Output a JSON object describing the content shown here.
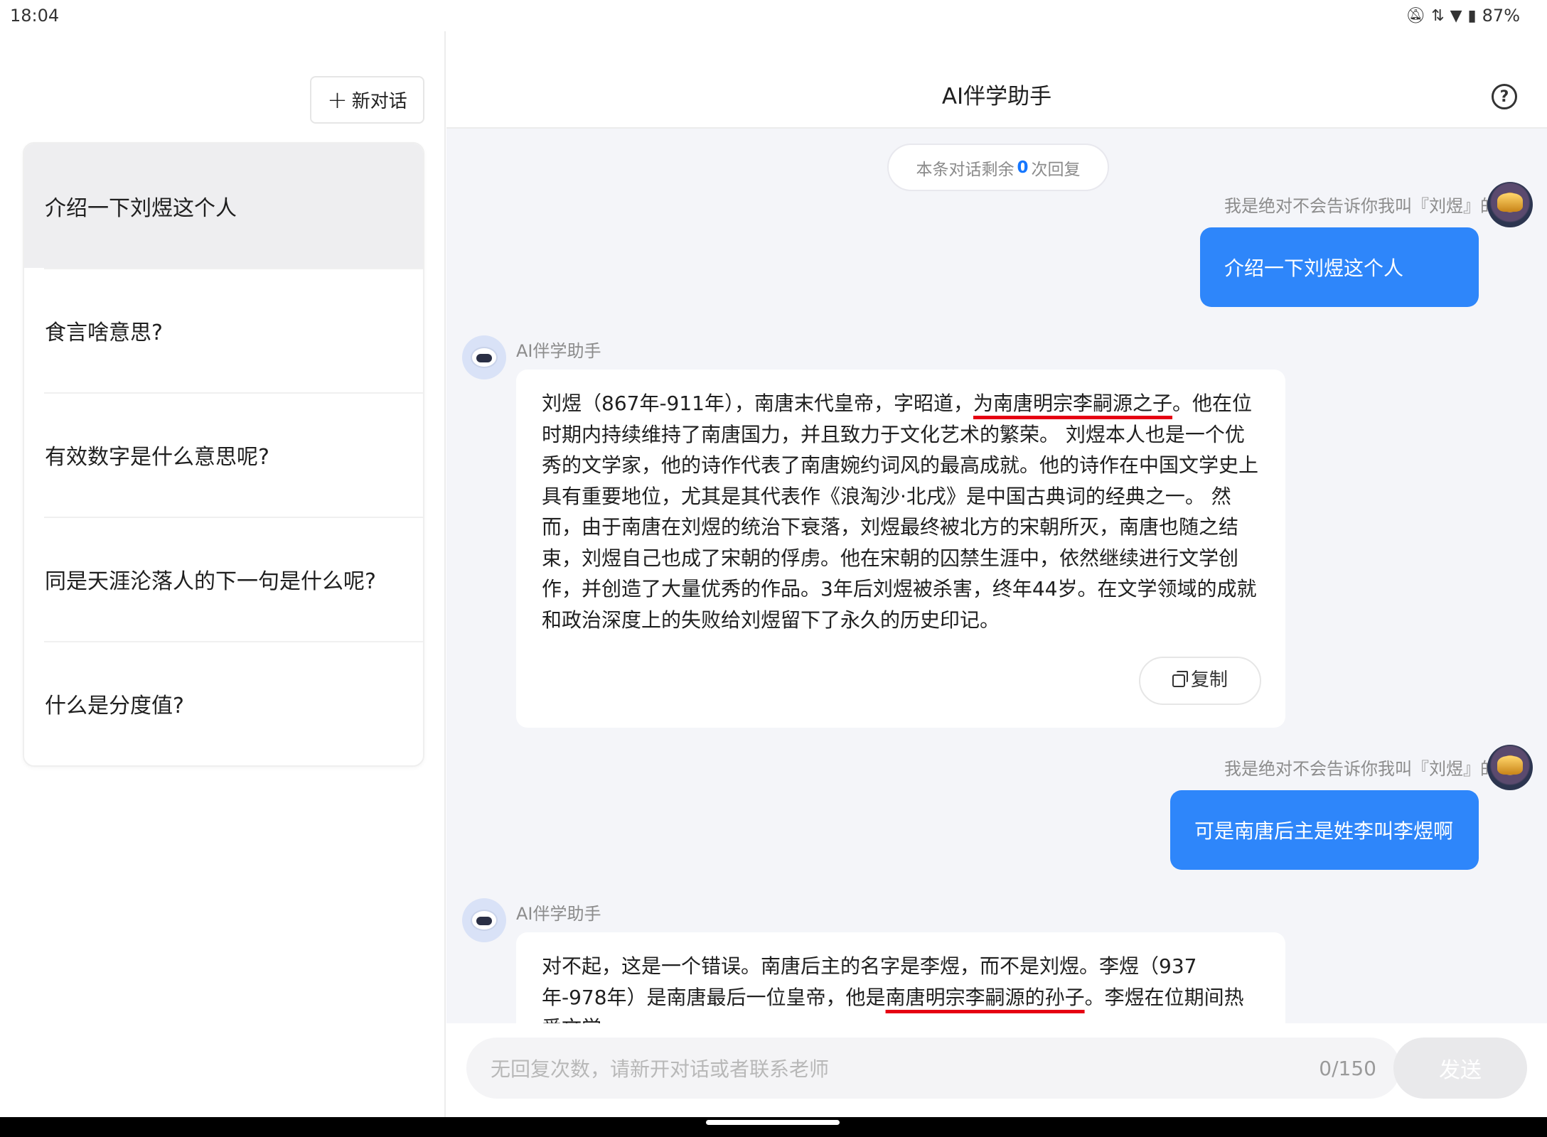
{
  "status_bar": {
    "time": "18:04",
    "battery": "87%",
    "icons": [
      "mute-icon",
      "data-icon",
      "wifi-icon",
      "battery-icon"
    ]
  },
  "sidebar": {
    "new_chat_label": "新对话",
    "conversations": [
      {
        "title": "介绍一下刘煜这个人",
        "active": true
      },
      {
        "title": "食言啥意思?",
        "active": false
      },
      {
        "title": "有效数字是什么意思呢?",
        "active": false
      },
      {
        "title": "同是天涯沦落人的下一句是什么呢?",
        "active": false
      },
      {
        "title": "什么是分度值?",
        "active": false
      }
    ]
  },
  "header": {
    "title": "AI伴学助手",
    "help_icon": "help-icon"
  },
  "chat": {
    "remaining": {
      "prefix": "本条对话剩余",
      "count": "0",
      "suffix": "次回复"
    },
    "messages": [
      {
        "role": "user",
        "name": "我是绝对不会告诉你我叫『刘煜』的",
        "text": "介绍一下刘煜这个人"
      },
      {
        "role": "ai",
        "name": "AI伴学助手",
        "text_before": "刘煜（867年-911年），南唐末代皇帝，字昭道，",
        "text_marked": "为南唐明宗李嗣源之子",
        "text_after": "。他在位时期内持续维持了南唐国力，并且致力于文化艺术的繁荣。 刘煜本人也是一个优秀的文学家，他的诗作代表了南唐婉约词风的最高成就。他的诗作在中国文学史上具有重要地位，尤其是其代表作《浪淘沙·北戌》是中国古典词的经典之一。 然而，由于南唐在刘煜的统治下衰落，刘煜最终被北方的宋朝所灭，南唐也随之结束，刘煜自己也成了宋朝的俘虏。他在宋朝的囚禁生涯中，依然继续进行文学创作，并创造了大量优秀的作品。3年后刘煜被杀害，终年44岁。在文学领域的成就和政治深度上的失败给刘煜留下了永久的历史印记。",
        "copy_label": "复制"
      },
      {
        "role": "user",
        "name": "我是绝对不会告诉你我叫『刘煜』的",
        "text": "可是南唐后主是姓李叫李煜啊"
      },
      {
        "role": "ai",
        "name": "AI伴学助手",
        "text_before": "对不起，这是一个错误。南唐后主的名字是李煜，而不是刘煜。李煜（937年-978年）是南唐最后一位皇帝，他是",
        "text_marked": "南唐明宗李嗣源的孙子",
        "text_after": "。李煜在位期间热爱文学，"
      }
    ]
  },
  "input": {
    "placeholder": "无回复次数，请新开对话或者联系老师",
    "counter": "0/150",
    "send_label": "发送"
  },
  "colors": {
    "accent": "#2e86fa",
    "annotation": "#e60012",
    "chat_bg": "#f4f5f9"
  }
}
